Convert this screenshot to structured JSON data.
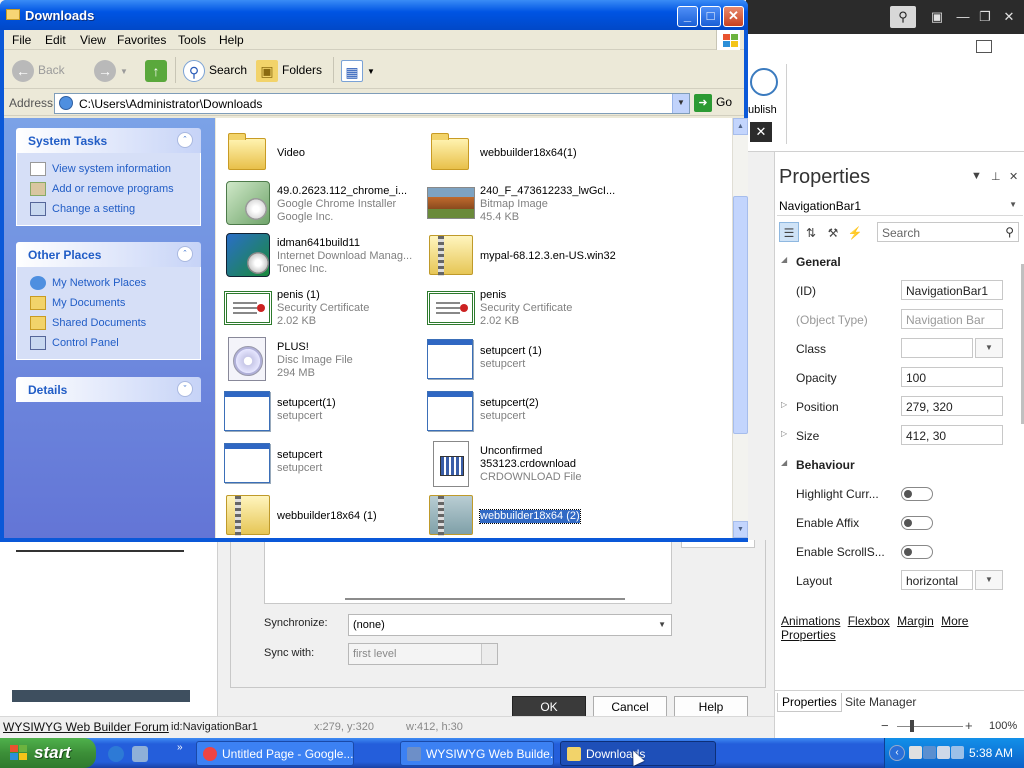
{
  "background_app": {
    "ribbon": {
      "publish_label": "ublish"
    },
    "left_preview": {
      "tiny_text": ""
    },
    "dialog": {
      "sync_label": "Synchronize:",
      "sync_value": "(none)",
      "sync_with_label": "Sync with:",
      "sync_with_value": "first level",
      "ok": "OK",
      "cancel": "Cancel",
      "help": "Help"
    },
    "statusbar": {
      "forum": "WYSIWYG Web Builder Forum",
      "id": "id:NavigationBar1",
      "pos": "x:279, y:320",
      "size": "w:412, h:30"
    },
    "properties": {
      "title": "Properties",
      "object": "NavigationBar1",
      "search_placeholder": "Search",
      "groups": {
        "general": "General",
        "behaviour": "Behaviour"
      },
      "rows": {
        "id": {
          "name": "(ID)",
          "value": "NavigationBar1"
        },
        "object_type": {
          "name": "(Object Type)",
          "value": "Navigation Bar"
        },
        "class": {
          "name": "Class",
          "value": ""
        },
        "opacity": {
          "name": "Opacity",
          "value": "100"
        },
        "position": {
          "name": "Position",
          "value": "279, 320"
        },
        "size": {
          "name": "Size",
          "value": "412, 30"
        },
        "highlight": {
          "name": "Highlight Curr..."
        },
        "affix": {
          "name": "Enable Affix"
        },
        "scrollspy": {
          "name": "Enable ScrollS..."
        },
        "layout": {
          "name": "Layout",
          "value": "horizontal"
        }
      },
      "links": [
        "Animations",
        "Flexbox",
        "Margin",
        "More Properties"
      ],
      "tabs": [
        "Properties",
        "Site Manager"
      ],
      "zoom": "100%"
    }
  },
  "explorer": {
    "title": "Downloads",
    "menu": [
      "File",
      "Edit",
      "View",
      "Favorites",
      "Tools",
      "Help"
    ],
    "toolbar": {
      "back": "Back",
      "search": "Search",
      "folders": "Folders"
    },
    "address": {
      "label": "Address",
      "value": "C:\\Users\\Administrator\\Downloads",
      "go": "Go"
    },
    "tasks": {
      "system_tasks": {
        "title": "System Tasks",
        "items": [
          "View system information",
          "Add or remove programs",
          "Change a setting"
        ]
      },
      "other_places": {
        "title": "Other Places",
        "items": [
          "My Network Places",
          "My Documents",
          "Shared Documents",
          "Control Panel"
        ]
      },
      "details": {
        "title": "Details"
      }
    },
    "files": [
      {
        "name": "Video",
        "line2": "",
        "line3": "",
        "icon": "folder-icon"
      },
      {
        "name": "webbuilder18x64(1)",
        "line2": "",
        "line3": "",
        "icon": "folder-icon"
      },
      {
        "name": "49.0.2623.112_chrome_i...",
        "line2": "Google Chrome Installer",
        "line3": "Google Inc.",
        "icon": "installer-icon"
      },
      {
        "name": "240_F_473612233_lwGcI...",
        "line2": "Bitmap Image",
        "line3": "45.4 KB",
        "icon": "bitmap-icon"
      },
      {
        "name": "idman641build11",
        "line2": "Internet Download Manag...",
        "line3": "Tonec Inc.",
        "icon": "idm-icon"
      },
      {
        "name": "mypal-68.12.3.en-US.win32",
        "line2": "",
        "line3": "",
        "icon": "zip-folder-icon"
      },
      {
        "name": "penis (1)",
        "line2": "Security Certificate",
        "line3": "2.02 KB",
        "icon": "certificate-icon"
      },
      {
        "name": "penis",
        "line2": "Security Certificate",
        "line3": "2.02 KB",
        "icon": "certificate-icon"
      },
      {
        "name": "PLUS!",
        "line2": "Disc Image File",
        "line3": "294 MB",
        "icon": "disc-image-icon"
      },
      {
        "name": "setupcert (1)",
        "line2": "setupcert",
        "line3": "",
        "icon": "window-icon"
      },
      {
        "name": "setupcert(1)",
        "line2": "setupcert",
        "line3": "",
        "icon": "window-icon"
      },
      {
        "name": "setupcert(2)",
        "line2": "setupcert",
        "line3": "",
        "icon": "window-icon"
      },
      {
        "name": "setupcert",
        "line2": "setupcert",
        "line3": "",
        "icon": "window-icon"
      },
      {
        "name": "Unconfirmed",
        "line2": "353123.crdownload",
        "line3": "CRDOWNLOAD File",
        "icon": "crdownload-icon",
        "name_dark2": true
      },
      {
        "name": "webbuilder18x64 (1)",
        "line2": "",
        "line3": "",
        "icon": "zip-folder-icon"
      },
      {
        "name": "webbuilder18x64 (2)",
        "line2": "",
        "line3": "",
        "icon": "zip-folder-icon",
        "selected": true
      }
    ]
  },
  "taskbar": {
    "start": "start",
    "tasks": [
      {
        "label": "Untitled Page - Google..."
      },
      {
        "label": "WYSIWYG Web Builde..."
      },
      {
        "label": "Downloads"
      }
    ],
    "clock": "5:38 AM"
  },
  "colors": {
    "xp_blue": "#0054e3",
    "taskpane_link": "#215dc6",
    "selection": "#316ac5",
    "start_green": "#3c8f38"
  }
}
